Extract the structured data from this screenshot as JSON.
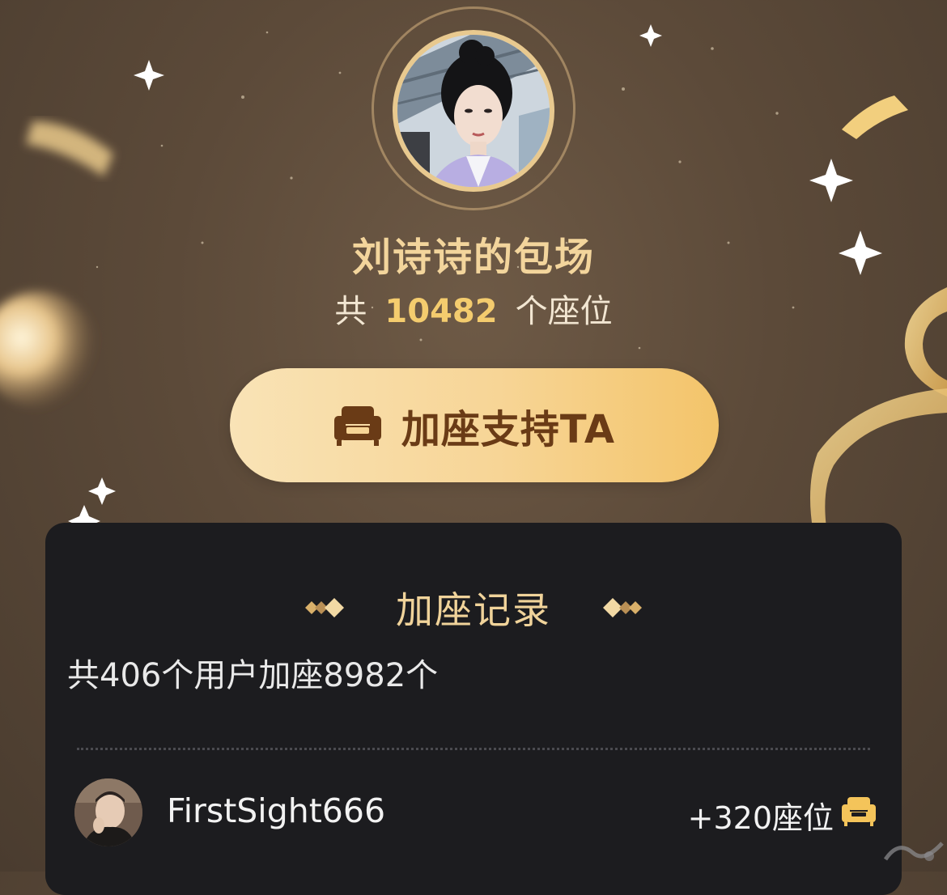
{
  "header": {
    "title": "刘诗诗的包场",
    "seat_prefix": "共",
    "seat_count": "10482",
    "seat_suffix": "个座位"
  },
  "cta": {
    "label": "加座支持TA",
    "icon": "sofa-icon"
  },
  "records": {
    "title": "加座记录",
    "summary": "共406个用户加座8982个",
    "items": [
      {
        "name": "FirstSight666",
        "count": "+320座位",
        "icon": "sofa-icon"
      }
    ]
  },
  "colors": {
    "background": "#5c4a39",
    "gold": "#f3d59c",
    "accent": "#f4cc6e",
    "button": "#f7d596",
    "button_text": "#6a3b16",
    "panel": "#1c1c1f"
  }
}
